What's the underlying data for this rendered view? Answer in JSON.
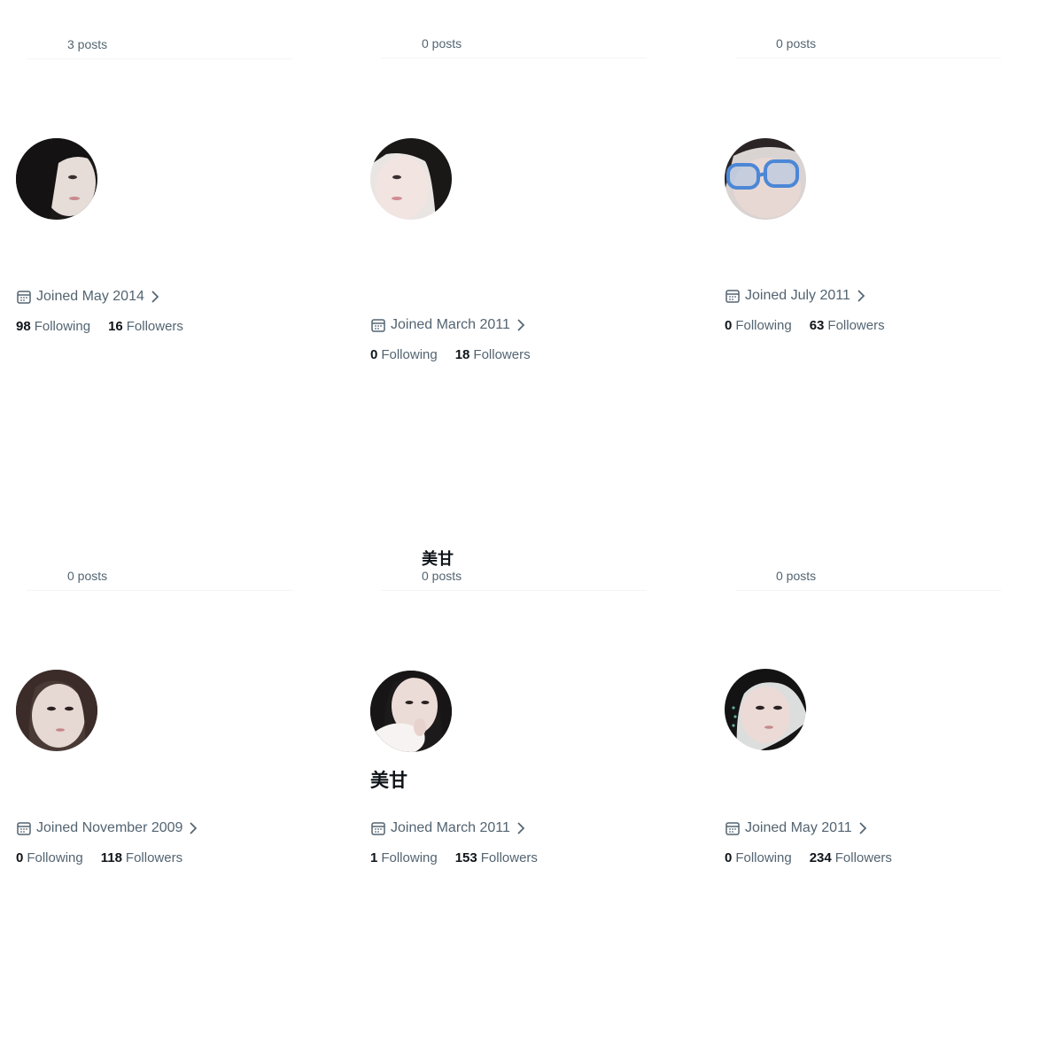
{
  "profiles": [
    {
      "header_name": "",
      "posts": "3 posts",
      "display_name": "",
      "joined": "Joined May 2014",
      "following_count": "98",
      "following_label": "Following",
      "followers_count": "16",
      "followers_label": "Followers"
    },
    {
      "header_name": "",
      "posts": "0 posts",
      "display_name": "",
      "joined": "Joined March 2011",
      "following_count": "0",
      "following_label": "Following",
      "followers_count": "18",
      "followers_label": "Followers"
    },
    {
      "header_name": "",
      "posts": "0 posts",
      "display_name": "",
      "joined": "Joined July 2011",
      "following_count": "0",
      "following_label": "Following",
      "followers_count": "63",
      "followers_label": "Followers"
    },
    {
      "header_name": "",
      "posts": "0 posts",
      "display_name": "",
      "joined": "Joined November 2009",
      "following_count": "0",
      "following_label": "Following",
      "followers_count": "118",
      "followers_label": "Followers"
    },
    {
      "header_name": "美甘",
      "posts": "0 posts",
      "display_name": "美甘",
      "joined": "Joined March 2011",
      "following_count": "1",
      "following_label": "Following",
      "followers_count": "153",
      "followers_label": "Followers"
    },
    {
      "header_name": "",
      "posts": "0 posts",
      "display_name": "",
      "joined": "Joined May 2011",
      "following_count": "0",
      "following_label": "Following",
      "followers_count": "234",
      "followers_label": "Followers"
    }
  ],
  "icons": {
    "joined": "calendar-icon",
    "more": "chevron-right-icon"
  },
  "colors": {
    "text_primary": "#0f1419",
    "text_secondary": "#536471",
    "background": "#ffffff"
  }
}
